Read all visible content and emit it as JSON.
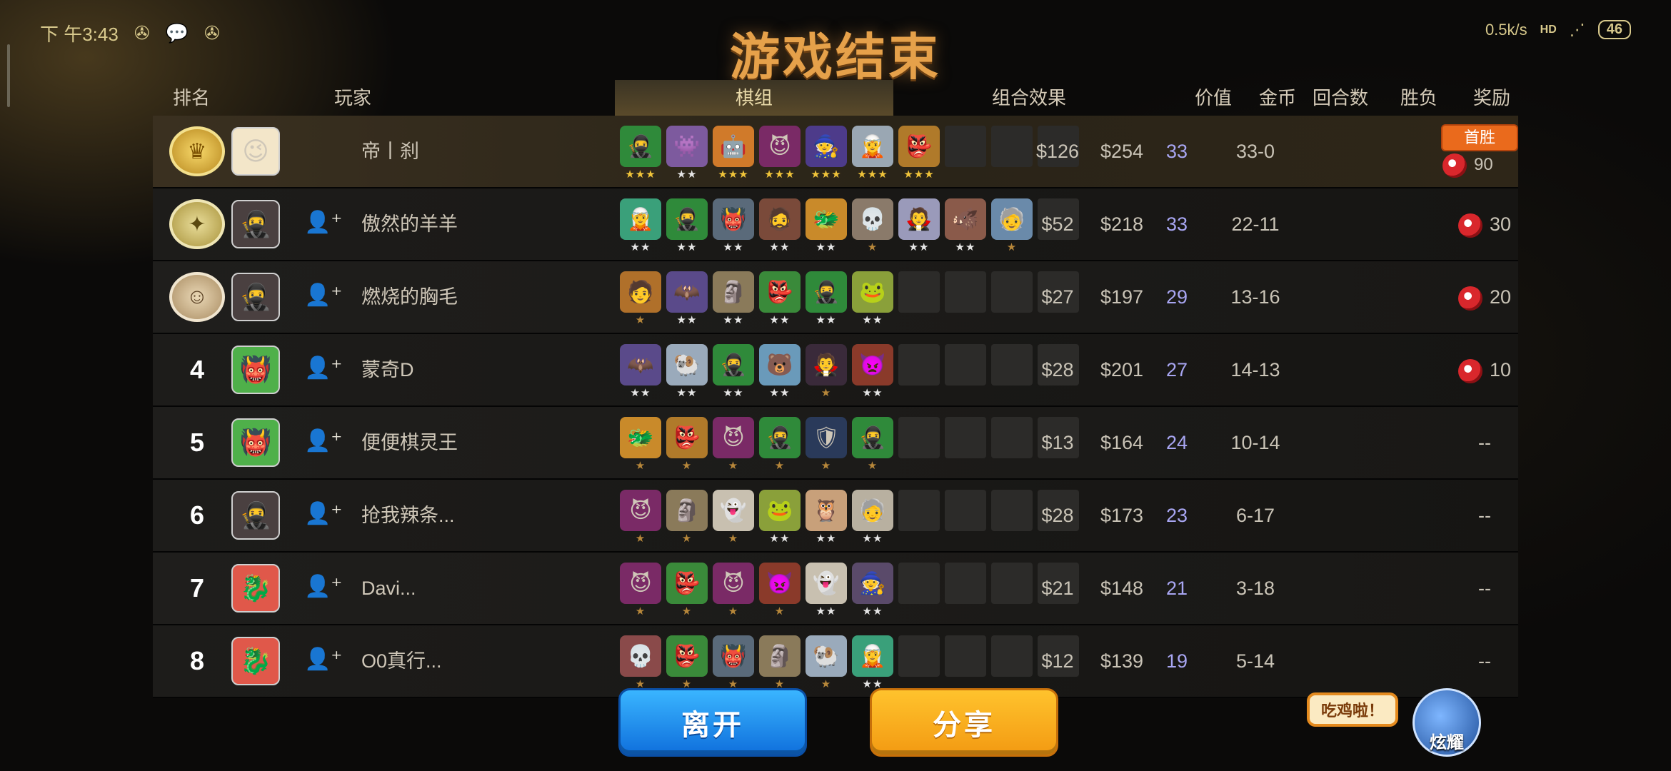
{
  "status_bar": {
    "time": "下 午3:43",
    "icons": [
      "compass-icon",
      "wechat-icon",
      "compass-icon"
    ]
  },
  "top_right": {
    "speed": "0.5k/s",
    "hd": "HD",
    "battery": "46"
  },
  "title": "游戏结束",
  "headers": {
    "rank": "排名",
    "player": "玩家",
    "pieces": "棋组",
    "combo": "组合效果",
    "value": "价值",
    "gold": "金币",
    "rounds": "回合数",
    "wl": "胜负",
    "reward": "奖励"
  },
  "rows": [
    {
      "rank": "",
      "medal": "gold",
      "avatar": "😉",
      "avatar_bg": "#f3e6c9",
      "friend": false,
      "name": "帝丨刹",
      "value": "$126",
      "gold": "$254",
      "rounds": "33",
      "wl": "33-0",
      "reward": "90",
      "badge": "首胜",
      "pieces": [
        {
          "e": "🥷",
          "bg": "#2f8a3a",
          "s": "★★★"
        },
        {
          "e": "👾",
          "bg": "#7d5a9e",
          "s": "★★"
        },
        {
          "e": "🤖",
          "bg": "#d07a2a",
          "s": "★★★"
        },
        {
          "e": "😈",
          "bg": "#7a2a66",
          "s": "★★★"
        },
        {
          "e": "🧙",
          "bg": "#4d3b8a",
          "s": "★★★"
        },
        {
          "e": "🧝",
          "bg": "#9aa7b3",
          "s": "★★★"
        },
        {
          "e": "👺",
          "bg": "#b07a2a",
          "s": "★★★"
        }
      ]
    },
    {
      "rank": "",
      "medal": "silver",
      "avatar": "🥷",
      "avatar_bg": "#4a4040",
      "friend": true,
      "name": "傲然的羊羊",
      "value": "$52",
      "gold": "$218",
      "rounds": "33",
      "wl": "22-11",
      "reward": "30",
      "pieces": [
        {
          "e": "🧝",
          "bg": "#3aa07a",
          "s": "★★"
        },
        {
          "e": "🥷",
          "bg": "#2f8a3a",
          "s": "★★"
        },
        {
          "e": "👹",
          "bg": "#5a6a7a",
          "s": "★★"
        },
        {
          "e": "🧔",
          "bg": "#7a4a3a",
          "s": "★★"
        },
        {
          "e": "🐲",
          "bg": "#c98a2a",
          "s": "★★"
        },
        {
          "e": "💀",
          "bg": "#8a7a6a",
          "s": "★"
        },
        {
          "e": "🧛",
          "bg": "#9a9aba",
          "s": "★★"
        },
        {
          "e": "🐗",
          "bg": "#8a5a4a",
          "s": "★★"
        },
        {
          "e": "🧓",
          "bg": "#6a8aaa",
          "s": "★"
        }
      ]
    },
    {
      "rank": "",
      "medal": "bronze",
      "avatar": "🥷",
      "avatar_bg": "#4a4040",
      "friend": true,
      "name": "燃烧的胸毛",
      "value": "$27",
      "gold": "$197",
      "rounds": "29",
      "wl": "13-16",
      "reward": "20",
      "pieces": [
        {
          "e": "🧑",
          "bg": "#b0702a",
          "s": "★"
        },
        {
          "e": "🦇",
          "bg": "#5a4a8a",
          "s": "★★"
        },
        {
          "e": "🗿",
          "bg": "#8a7a5a",
          "s": "★★"
        },
        {
          "e": "👺",
          "bg": "#3a8a3a",
          "s": "★★"
        },
        {
          "e": "🥷",
          "bg": "#2f8a3a",
          "s": "★★"
        },
        {
          "e": "🐸",
          "bg": "#8aa03a",
          "s": "★★"
        }
      ]
    },
    {
      "rank": "4",
      "medal": "",
      "avatar": "👹",
      "avatar_bg": "#4fb04a",
      "friend": true,
      "name": "蒙奇D",
      "value": "$28",
      "gold": "$201",
      "rounds": "27",
      "wl": "14-13",
      "reward": "10",
      "pieces": [
        {
          "e": "🦇",
          "bg": "#5a4a8a",
          "s": "★★"
        },
        {
          "e": "🐏",
          "bg": "#9aaabb",
          "s": "★★"
        },
        {
          "e": "🥷",
          "bg": "#2f8a3a",
          "s": "★★"
        },
        {
          "e": "🐻",
          "bg": "#6a9aba",
          "s": "★★"
        },
        {
          "e": "🧛",
          "bg": "#3a2a3a",
          "s": "★"
        },
        {
          "e": "👿",
          "bg": "#8a3a2a",
          "s": "★★"
        }
      ]
    },
    {
      "rank": "5",
      "medal": "",
      "avatar": "👹",
      "avatar_bg": "#4fb04a",
      "friend": true,
      "name": "便便棋灵王",
      "value": "$13",
      "gold": "$164",
      "rounds": "24",
      "wl": "10-14",
      "reward": "--",
      "pieces": [
        {
          "e": "🐲",
          "bg": "#c98a2a",
          "s": "★"
        },
        {
          "e": "👺",
          "bg": "#b07a2a",
          "s": "★"
        },
        {
          "e": "😈",
          "bg": "#7a2a66",
          "s": "★"
        },
        {
          "e": "🥷",
          "bg": "#2f8a3a",
          "s": "★"
        },
        {
          "e": "🛡",
          "bg": "#2a3a5a",
          "s": "★"
        },
        {
          "e": "🥷",
          "bg": "#2f8a3a",
          "s": "★"
        }
      ]
    },
    {
      "rank": "6",
      "medal": "",
      "avatar": "🥷",
      "avatar_bg": "#4a4040",
      "friend": true,
      "name": "抢我辣条...",
      "value": "$28",
      "gold": "$173",
      "rounds": "23",
      "wl": "6-17",
      "reward": "--",
      "pieces": [
        {
          "e": "😈",
          "bg": "#7a2a66",
          "s": "★"
        },
        {
          "e": "🗿",
          "bg": "#8a7a5a",
          "s": "★"
        },
        {
          "e": "👻",
          "bg": "#c8c0b0",
          "s": "★"
        },
        {
          "e": "🐸",
          "bg": "#8aa03a",
          "s": "★★"
        },
        {
          "e": "🦉",
          "bg": "#c8a07a",
          "s": "★★"
        },
        {
          "e": "🧓",
          "bg": "#b8b0a0",
          "s": "★★"
        }
      ]
    },
    {
      "rank": "7",
      "medal": "",
      "avatar": "🐉",
      "avatar_bg": "#e0584a",
      "friend": true,
      "name": "Davi...",
      "value": "$21",
      "gold": "$148",
      "rounds": "21",
      "wl": "3-18",
      "reward": "--",
      "pieces": [
        {
          "e": "😈",
          "bg": "#7a2a66",
          "s": "★"
        },
        {
          "e": "👺",
          "bg": "#3a8a3a",
          "s": "★"
        },
        {
          "e": "😈",
          "bg": "#7a2a66",
          "s": "★"
        },
        {
          "e": "👿",
          "bg": "#8a3a2a",
          "s": "★"
        },
        {
          "e": "👻",
          "bg": "#c8c0b0",
          "s": "★★"
        },
        {
          "e": "🧙",
          "bg": "#5a4a6a",
          "s": "★★"
        }
      ]
    },
    {
      "rank": "8",
      "medal": "",
      "avatar": "🐉",
      "avatar_bg": "#e0584a",
      "friend": true,
      "name": "O0真行...",
      "value": "$12",
      "gold": "$139",
      "rounds": "19",
      "wl": "5-14",
      "reward": "--",
      "pieces": [
        {
          "e": "💀",
          "bg": "#8a4a4a",
          "s": "★"
        },
        {
          "e": "👺",
          "bg": "#3a8a3a",
          "s": "★"
        },
        {
          "e": "👹",
          "bg": "#5a6a7a",
          "s": "★"
        },
        {
          "e": "🗿",
          "bg": "#8a7a5a",
          "s": "★"
        },
        {
          "e": "🐏",
          "bg": "#9aaabb",
          "s": "★"
        },
        {
          "e": "🧝",
          "bg": "#3aa07a",
          "s": "★★"
        }
      ]
    }
  ],
  "buttons": {
    "leave": "离开",
    "share": "分享"
  },
  "bubble": "吃鸡啦！",
  "mascot_label": "炫耀"
}
